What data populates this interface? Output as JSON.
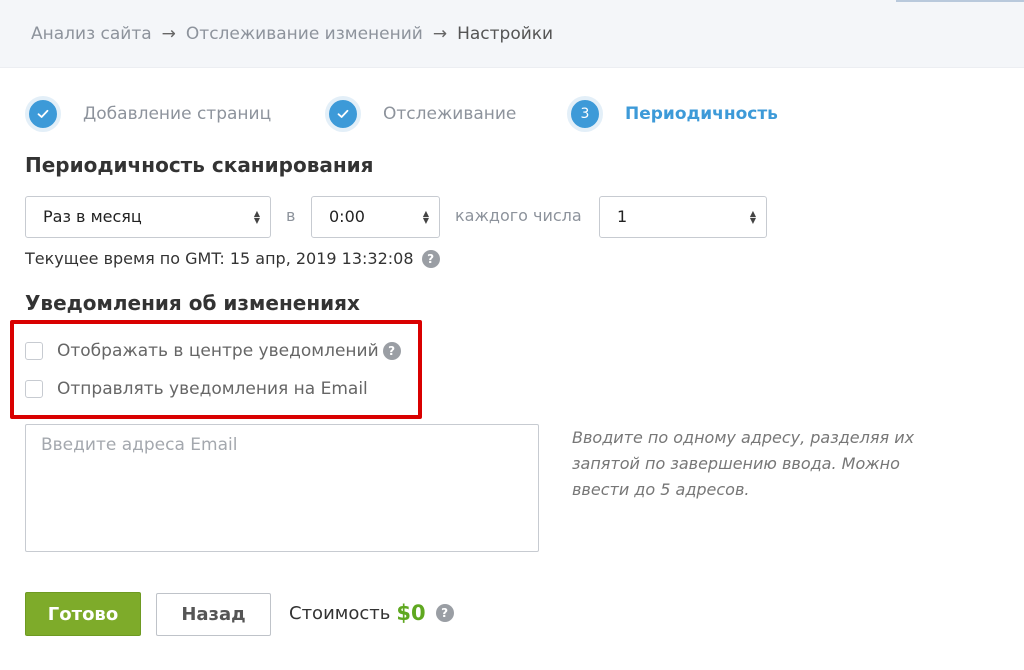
{
  "breadcrumb": {
    "items": [
      "Анализ сайта",
      "Отслеживание изменений",
      "Настройки"
    ],
    "separator": "→"
  },
  "steps": [
    {
      "label": "Добавление страниц",
      "state": "done",
      "icon": "check-icon"
    },
    {
      "label": "Отслеживание",
      "state": "done",
      "icon": "check-icon"
    },
    {
      "label": "Периодичность",
      "state": "active",
      "number": "3"
    }
  ],
  "scan": {
    "title": "Периодичность сканирования",
    "frequency": "Раз в месяц",
    "at_word": "в",
    "time": "0:00",
    "each_word": "каждого числа",
    "day": "1",
    "gmt_text": "Текущее время по GMT: 15 апр, 2019 13:32:08"
  },
  "notifications": {
    "title": "Уведомления об изменениях",
    "option_center": "Отображать в центре уведомлений",
    "option_email": "Отправлять уведомления на Email",
    "email_placeholder": "Введите адреса Email",
    "hint": "Вводите по одному адресу, разделяя их запятой по завершению ввода. Можно ввести до 5 адресов."
  },
  "actions": {
    "done_label": "Готово",
    "back_label": "Назад",
    "cost_label": "Стоимость",
    "cost_value": "$0"
  },
  "help_glyph": "?",
  "colors": {
    "accent": "#3d9ad8",
    "done_button": "#7eab2a",
    "price": "#5fa820",
    "highlight_box": "#d90000"
  }
}
